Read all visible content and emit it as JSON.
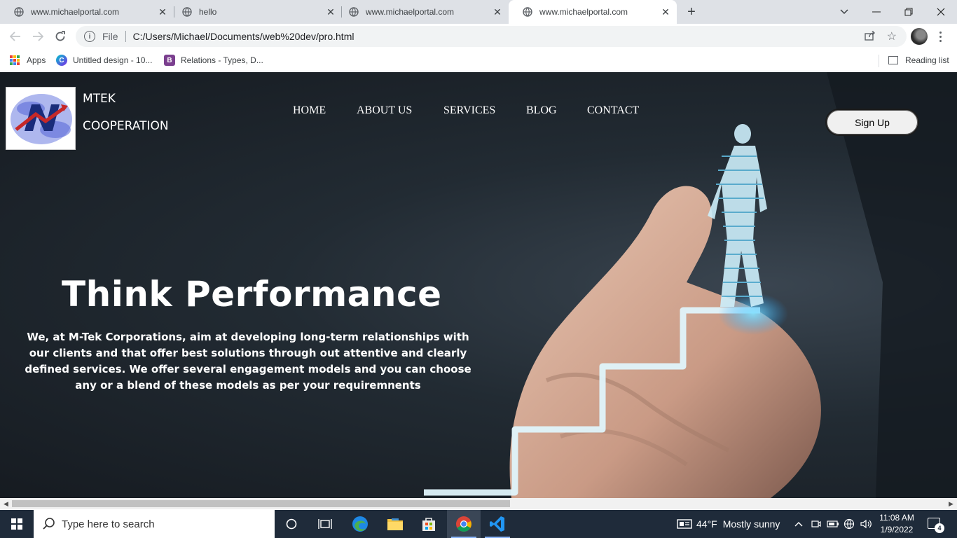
{
  "browser": {
    "tabs": [
      {
        "title": "www.michaelportal.com"
      },
      {
        "title": "hello"
      },
      {
        "title": "www.michaelportal.com"
      },
      {
        "title": "www.michaelportal.com"
      }
    ],
    "address": {
      "scheme": "File",
      "url": "C:/Users/Michael/Documents/web%20dev/pro.html"
    },
    "bookmarks": [
      {
        "label": "Apps"
      },
      {
        "label": "Untitled design - 10..."
      },
      {
        "label": "Relations - Types, D..."
      }
    ],
    "reading_list": "Reading list"
  },
  "site": {
    "brand_line1": "MTEK",
    "brand_line2": "COOPERATION",
    "nav": [
      "HOME",
      "ABOUT US",
      "SERVICES",
      "BLOG",
      "CONTACT"
    ],
    "signup": "Sign Up",
    "hero_title": "Think Performance",
    "hero_text": "We, at M-Tek Corporations, aim at developing long-term relationships with our clients and that offer best solutions through out attentive and clearly defined services. We offer several engagement models and you can choose any or a blend of these models as per your requiremnents"
  },
  "taskbar": {
    "search_placeholder": "Type here to search",
    "weather_temp": "44°F",
    "weather_desc": "Mostly sunny",
    "time": "11:08 AM",
    "date": "1/9/2022",
    "notifications": "4"
  }
}
